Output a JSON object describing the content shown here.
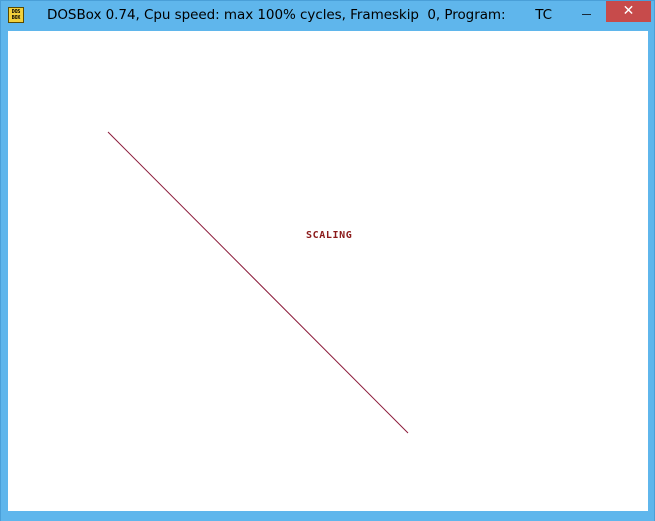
{
  "window": {
    "icon_text": "DOS BOX",
    "title": "DOSBox 0.74, Cpu speed: max 100% cycles, Frameskip  0, Program:       TC",
    "close_glyph": "✕",
    "accent_color": "#5fb6ec",
    "close_color": "#c74b4b"
  },
  "canvas": {
    "label": "SCALING",
    "line_color": "#8b1a3a",
    "label_color": "#8b1a1a"
  }
}
